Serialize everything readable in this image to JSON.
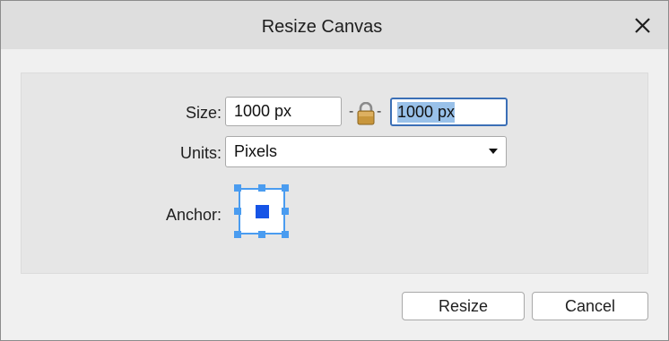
{
  "dialog": {
    "title": "Resize Canvas",
    "close_icon": "close-icon"
  },
  "size": {
    "label": "Size:",
    "width_value": "1000 px",
    "height_value": "1000 px",
    "lock_icon": "lock-icon",
    "link_dash": "-"
  },
  "units": {
    "label": "Units:",
    "selected": "Pixels",
    "arrow_icon": "dropdown-arrow-icon"
  },
  "anchor": {
    "label": "Anchor:",
    "selected": "center"
  },
  "buttons": {
    "resize": "Resize",
    "cancel": "Cancel"
  },
  "colors": {
    "accent": "#4a9cf0",
    "anchor_selected": "#1654e6",
    "selection": "#99c1e9",
    "focus_border": "#3b6fb6"
  }
}
